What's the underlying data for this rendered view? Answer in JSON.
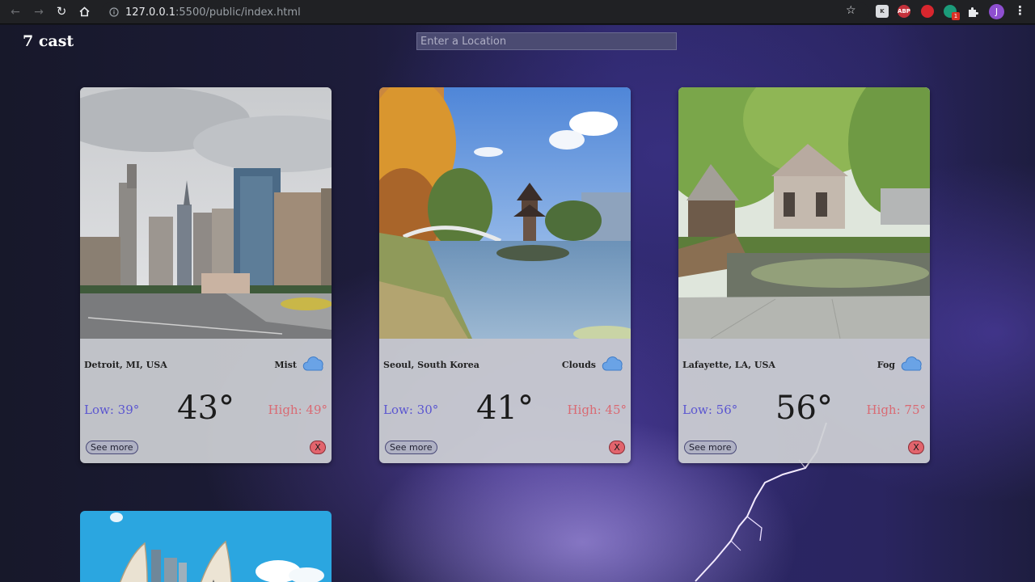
{
  "browser": {
    "url_host": "127.0.0.1",
    "url_path": ":5500/public/index.html",
    "profile_initial": "J",
    "ext_badge": "1",
    "ext_k": "K",
    "ext_abp": "ABP"
  },
  "header": {
    "logo": "7 cast",
    "search_placeholder": "Enter a Location"
  },
  "cards": [
    {
      "city": "Detroit, MI, USA",
      "condition": "Mist",
      "icon": "cloud-icon",
      "low": "Low: 39°",
      "temp": "43°",
      "high": "High: 49°",
      "see_more": "See more",
      "remove": "X"
    },
    {
      "city": "Seoul, South Korea",
      "condition": "Clouds",
      "icon": "cloud-icon",
      "low": "Low: 30°",
      "temp": "41°",
      "high": "High: 45°",
      "see_more": "See more",
      "remove": "X"
    },
    {
      "city": "Lafayette, LA, USA",
      "condition": "Fog",
      "icon": "cloud-icon",
      "low": "Low: 56°",
      "temp": "56°",
      "high": "High: 75°",
      "see_more": "See more",
      "remove": "X"
    }
  ],
  "colors": {
    "low": "#5a55d0",
    "high": "#d96a73",
    "remove_button": "#e2646d",
    "cloud": "#6aa3e6"
  }
}
